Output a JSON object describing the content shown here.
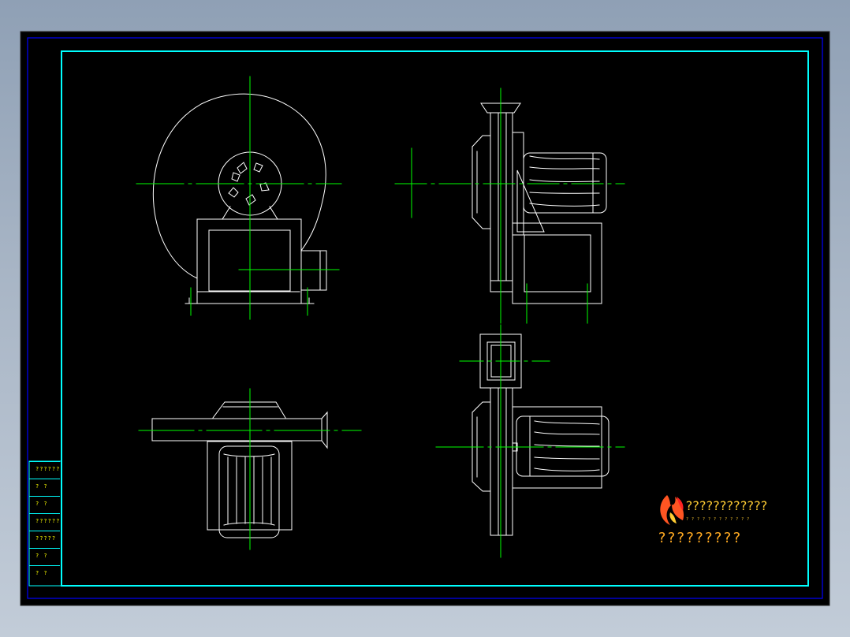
{
  "colors": {
    "background": "#8fa0b5",
    "sheet": "#000000",
    "outer_border": "#0000ff",
    "inner_border": "#00ffff",
    "outline": "#ffffff",
    "centerline": "#00ff00",
    "label_text": "#ffff00",
    "logo_text": "#ffcc33"
  },
  "side_table": {
    "cells": [
      "??????",
      "? ?",
      "? ?",
      "??????",
      "?????",
      "? ?",
      "? ?"
    ]
  },
  "logo": {
    "icon": "flame-logo-icon",
    "line1": "????????????",
    "line2": "????????????",
    "caption": "?????????"
  },
  "views": [
    "front-view",
    "side-view",
    "top-view",
    "back-view"
  ]
}
